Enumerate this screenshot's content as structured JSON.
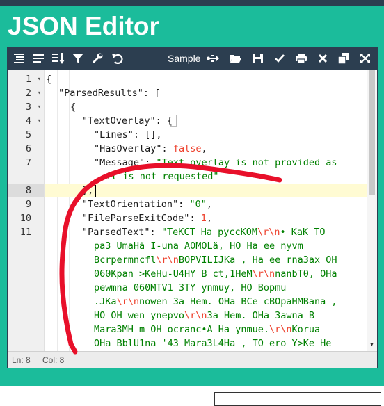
{
  "app": {
    "title": "JSON Editor"
  },
  "toolbar": {
    "sample_label": "Sample",
    "left_icons": [
      "format-icon",
      "compact-icon",
      "sort-icon",
      "filter-icon",
      "repair-icon",
      "undo-icon"
    ],
    "right_icons": [
      "upload-icon",
      "open-file-icon",
      "save-icon",
      "validate-icon",
      "print-icon",
      "clear-icon",
      "copy-icon",
      "fullscreen-icon"
    ]
  },
  "gutter": {
    "numbers": [
      "1",
      "2",
      "3",
      "4",
      "5",
      "6",
      "7",
      "",
      "8",
      "9",
      "10",
      "11"
    ],
    "folds": [
      "▾",
      "▾",
      "▾",
      "▾",
      "",
      "",
      "",
      "",
      "",
      "",
      "",
      ""
    ]
  },
  "code": {
    "l1": "{",
    "l2_key": "\"ParsedResults\"",
    "l2_rest": ": [",
    "l3": "{",
    "l4_key": "\"TextOverlay\"",
    "l4_rest": ": {",
    "l5_key": "\"Lines\"",
    "l5_rest": ": [],",
    "l6_key": "\"HasOverlay\"",
    "l6_colon": ": ",
    "l6_val": "false",
    "l6_comma": ",",
    "l7_key": "\"Message\"",
    "l7_colon": ": ",
    "l7_val": "\"Text overlay is not provided as",
    "l7b_val": "it is not requested\"",
    "l8": "},",
    "l9_key": "\"TextOrientation\"",
    "l9_colon": ": ",
    "l9_val": "\"0\"",
    "l9_comma": ",",
    "l10_key": "\"FileParseExitCode\"",
    "l10_colon": ": ",
    "l10_val": "1",
    "l10_comma": ",",
    "l11_key": "\"ParsedText\"",
    "l11_colon": ": ",
    "pt1": "\"TeKCT Ha pyccKOM",
    "pt1_esc": "\\r\\n",
    "pt1_end": "• KaK TO",
    "pt2": "pa3 UmaHä I-una AOMOLä, HO Ha ee nyvm",
    "pt3a": "Bcrpermncfl",
    "pt3_esc": "\\r\\n",
    "pt3b": "BOPVILIJKa , Ha ee rna3ax OH",
    "pt4": "060Kpan >KeHu-U4HY B ct,1HeM",
    "pt4_esc": "\\r\\n",
    "pt4b": "nanbT0, OHa",
    "pt5": "pewmna 060MTV1 3TY ynmuy, HO Bopmu",
    "pt6a": ".JKa",
    "pt6_esc": "\\r\\n",
    "pt6b": "nowen 3a Hem. OHa BCe cBOpaHMBana ,",
    "pt7a": "HO OH wen ynepvo",
    "pt7_esc": "\\r\\n",
    "pt7b": "3a Hem. OHa 3awna B",
    "pt8a": "Mara3MH m OH ocranc•A Ha ynmue.",
    "pt8_esc": "\\r\\n",
    "pt8b": "Korua",
    "pt9": "OHa BblU1na '43 Mara3L4Ha , TO ero Y>Ke He"
  },
  "status": {
    "ln_label": "Ln: 8",
    "col_label": "Col: 8"
  },
  "colors": {
    "brand": "#1bbc9b",
    "toolbar": "#2c3e50",
    "string": "#008000",
    "literal": "#ee422e",
    "annotation": "#e8102a",
    "active_line": "#fffbd3"
  }
}
